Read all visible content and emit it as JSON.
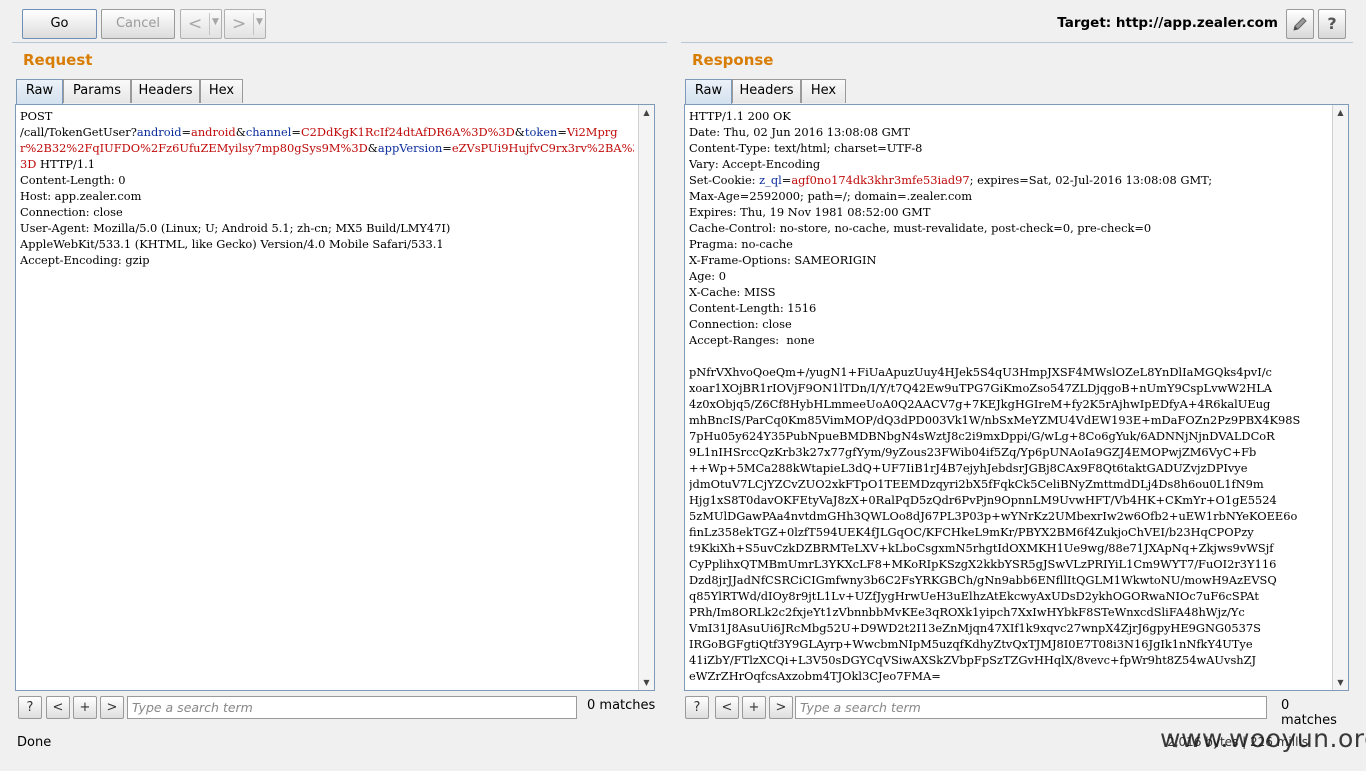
{
  "toolbar": {
    "go_label": "Go",
    "cancel_label": "Cancel",
    "back_icon": "back-arrow-icon",
    "forward_icon": "forward-arrow-icon",
    "target": "Target: http://app.zealer.com"
  },
  "request": {
    "title": "Request",
    "tabs": [
      "Raw",
      "Params",
      "Headers",
      "Hex"
    ],
    "active_tab": "Raw",
    "lines": [
      [
        [
          "e",
          "POST"
        ]
      ],
      [
        [
          "e",
          "/call/TokenGetUser?"
        ],
        [
          "k",
          "android"
        ],
        [
          "e",
          "="
        ],
        [
          "v",
          "android"
        ],
        [
          "e",
          "&"
        ],
        [
          "k",
          "channel"
        ],
        [
          "e",
          "="
        ],
        [
          "v",
          "C2DdKgK1RcIf24dtAfDR6A%3D%3D"
        ],
        [
          "e",
          "&"
        ],
        [
          "k",
          "token"
        ],
        [
          "e",
          "="
        ],
        [
          "v",
          "Vi2Mprg"
        ]
      ],
      [
        [
          "v",
          "r%2B32%2FqIUFDO%2Fz6UfuZEMyilsy7mp80gSys9M%3D"
        ],
        [
          "e",
          "&"
        ],
        [
          "k",
          "appVersion"
        ],
        [
          "e",
          "="
        ],
        [
          "v",
          "eZVsPUi9HujfvC9rx3rv%2BA%3D%"
        ]
      ],
      [
        [
          "v",
          "3D"
        ],
        [
          "e",
          " HTTP/1.1"
        ]
      ],
      [
        [
          "e",
          "Content-Length: 0"
        ]
      ],
      [
        [
          "e",
          "Host: app.zealer.com"
        ]
      ],
      [
        [
          "e",
          "Connection: close"
        ]
      ],
      [
        [
          "e",
          "User-Agent: Mozilla/5.0 (Linux; U; Android 5.1; zh-cn; MX5 Build/LMY47I)"
        ]
      ],
      [
        [
          "e",
          "AppleWebKit/533.1 (KHTML, like Gecko) Version/4.0 Mobile Safari/533.1"
        ]
      ],
      [
        [
          "e",
          "Accept-Encoding: gzip"
        ]
      ]
    ],
    "search": {
      "placeholder": "Type a search term",
      "matches": "0 matches"
    }
  },
  "response": {
    "title": "Response",
    "tabs": [
      "Raw",
      "Headers",
      "Hex"
    ],
    "active_tab": "Raw",
    "lines": [
      [
        [
          "e",
          "HTTP/1.1 200 OK"
        ]
      ],
      [
        [
          "e",
          "Date: Thu, 02 Jun 2016 13:08:08 GMT"
        ]
      ],
      [
        [
          "e",
          "Content-Type: text/html; charset=UTF-8"
        ]
      ],
      [
        [
          "e",
          "Vary: Accept-Encoding"
        ]
      ],
      [
        [
          "e",
          "Set-Cookie: "
        ],
        [
          "k",
          "z_ql"
        ],
        [
          "e",
          "="
        ],
        [
          "v",
          "agf0no174dk3khr3mfe53iad97"
        ],
        [
          "e",
          "; expires=Sat, 02-Jul-2016 13:08:08 GMT;"
        ]
      ],
      [
        [
          "e",
          "Max-Age=2592000; path=/; domain=.zealer.com"
        ]
      ],
      [
        [
          "e",
          "Expires: Thu, 19 Nov 1981 08:52:00 GMT"
        ]
      ],
      [
        [
          "e",
          "Cache-Control: no-store, no-cache, must-revalidate, post-check=0, pre-check=0"
        ]
      ],
      [
        [
          "e",
          "Pragma: no-cache"
        ]
      ],
      [
        [
          "e",
          "X-Frame-Options: SAMEORIGIN"
        ]
      ],
      [
        [
          "e",
          "Age: 0"
        ]
      ],
      [
        [
          "e",
          "X-Cache: MISS"
        ]
      ],
      [
        [
          "e",
          "Content-Length: 1516"
        ]
      ],
      [
        [
          "e",
          "Connection: close"
        ]
      ],
      [
        [
          "e",
          "Accept-Ranges:  none"
        ]
      ],
      [
        [
          "e",
          ""
        ]
      ],
      [
        [
          "e",
          "pNfrVXhvoQoeQm+/yugN1+FiUaApuzUuy4HJek5S4qU3HmpJXSF4MWslOZeL8YnDlIaMGQks4pvI/c"
        ]
      ],
      [
        [
          "e",
          "xoar1XOjBR1rIOVjF9ON1lTDn/I/Y/t7Q42Ew9uTPG7GiKmoZso547ZLDjqgoB+nUmY9CspLvwW2HLA"
        ]
      ],
      [
        [
          "e",
          "4z0xObjq5/Z6Cf8HybHLmmeeUoA0Q2AACV7g+7KEJkgHGIreM+fy2K5rAjhwIpEDfyA+4R6kalUEug"
        ]
      ],
      [
        [
          "e",
          "mhBncIS/ParCq0Km85VimMOP/dQ3dPD003Vk1W/nbSxMeYZMU4VdEW193E+mDaFOZn2Pz9PBX4K98S"
        ]
      ],
      [
        [
          "e",
          "7pHu05y624Y35PubNpueBMDBNbgN4sWztJ8c2i9mxDppi/G/wLg+8Co6gYuk/6ADNNjNjnDVALDCoR"
        ]
      ],
      [
        [
          "e",
          "9L1nIHSrccQzKrb3k27x77gfYym/9yZous23FWib04if5Zq/Yp6pUNAoIa9GZJ4EMOPwjZM6VyC+Fb"
        ]
      ],
      [
        [
          "e",
          "++Wp+5MCa288kWtapieL3dQ+UF7IiB1rJ4B7ejyhJebdsrJGBj8CAx9F8Qt6taktGADUZvjzDPIvye"
        ]
      ],
      [
        [
          "e",
          "jdmOtuV7LCjYZCvZUO2xkFTpO1TEEMDzqyri2bX5fFqkCk5CeliBNyZmttmdDLj4Ds8h6ou0L1fN9m"
        ]
      ],
      [
        [
          "e",
          "Hjg1xS8T0davOKFEtyVaJ8zX+0RalPqD5zQdr6PvPjn9OpnnLM9UvwHFT/Vb4HK+CKmYr+O1gE5524"
        ]
      ],
      [
        [
          "e",
          "5zMUlDGawPAa4nvtdmGHh3QWLOo8dJ67PL3P03p+wYNrKz2UMbexrIw2w6Ofb2+uEW1rbNYeKOEE6o"
        ]
      ],
      [
        [
          "e",
          "finLz358ekTGZ+0lzfT594UEK4fJLGqOC/KFCHkeL9mKr/PBYX2BM6f4ZukjoChVEI/b23HqCPOPzy"
        ]
      ],
      [
        [
          "e",
          "t9KkiXh+S5uvCzkDZBRMTeLXV+kLboCsgxmN5rhgtIdOXMKH1Ue9wg/88e71JXApNq+Zkjws9vWSjf"
        ]
      ],
      [
        [
          "e",
          "CyPplihxQTMBmUmrL3YKXcLF8+MKoRIpKSzgX2kkbYSR5gJSwVLzPRIYiL1Cm9WYT7/FuOI2r3Y116"
        ]
      ],
      [
        [
          "e",
          "Dzd8jrJJadNfCSRCiCIGmfwny3b6C2FsYRKGBCh/gNn9abb6ENfllItQGLM1WkwtoNU/mowH9AzEVSQ"
        ]
      ],
      [
        [
          "e",
          "q85YlRTWd/dIOy8r9jtL1Lv+UZfJygHrwUeH3uElhzAtEkcwyAxUDsD2ykhOGORwaNIOc7uF6cSPAt"
        ]
      ],
      [
        [
          "e",
          "PRh/Im8ORLk2c2fxjeYt1zVbnnbbMvKEe3qROXk1yipch7XxIwHYbkF8STeWnxcdSliFA48hWjz/Yc"
        ]
      ],
      [
        [
          "e",
          "VmI31J8AsuUi6JRcMbg52U+D9WD2t2I13eZnMjqn47XIf1k9xqvc27wnpX4ZjrJ6gpyHE9GNG0537S"
        ]
      ],
      [
        [
          "e",
          "IRGoBGFgtiQtf3Y9GLAyrp+WwcbmNIpM5uzqfKdhyZtvQxTJMJ8I0E7T08i3N16JgIk1nNfkY4UTye"
        ]
      ],
      [
        [
          "e",
          "41iZbY/FTlzXCQi+L3V50sDGYCqVSiwAXSkZVbpFpSzTZGvHHqlX/8vevc+fpWr9ht8Z54wAUvshZJ"
        ]
      ],
      [
        [
          "e",
          "eWZrZHrOqfcsAxzobm4TJOkl3CJeo7FMA="
        ]
      ]
    ],
    "search": {
      "placeholder": "Type a search term",
      "matches": "0 matches"
    }
  },
  "status": {
    "left": "Done",
    "right": "2,016 bytes | 226 millis"
  },
  "watermark": "www.wooyun.org"
}
